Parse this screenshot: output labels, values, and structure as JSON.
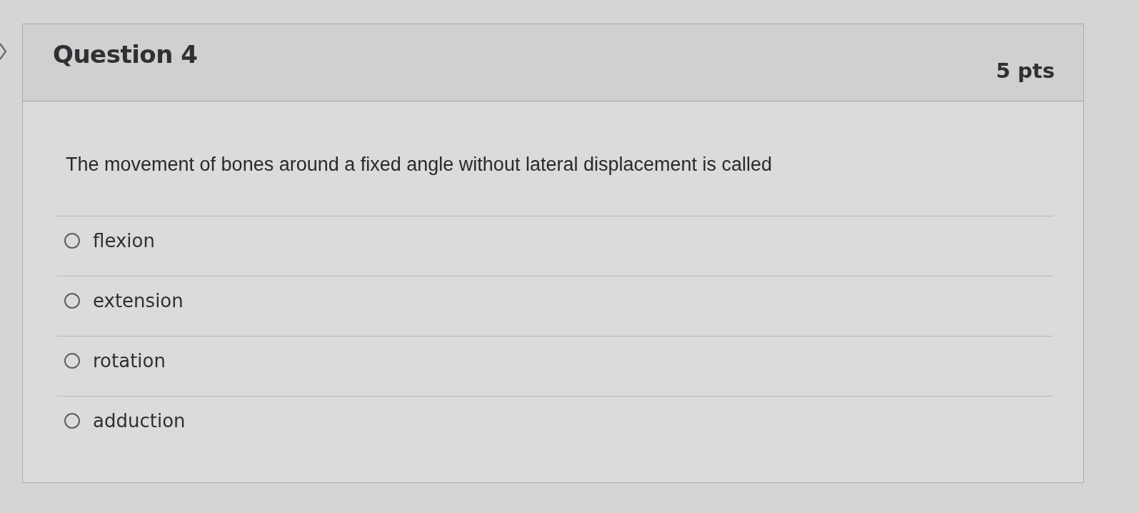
{
  "question": {
    "title": "Question 4",
    "points": "5 pts",
    "text": "The movement of bones around a fixed angle without lateral displacement is called"
  },
  "answers": [
    {
      "label": "flexion",
      "selected": false
    },
    {
      "label": "extension",
      "selected": false
    },
    {
      "label": "rotation",
      "selected": false
    },
    {
      "label": "adduction",
      "selected": false
    }
  ]
}
